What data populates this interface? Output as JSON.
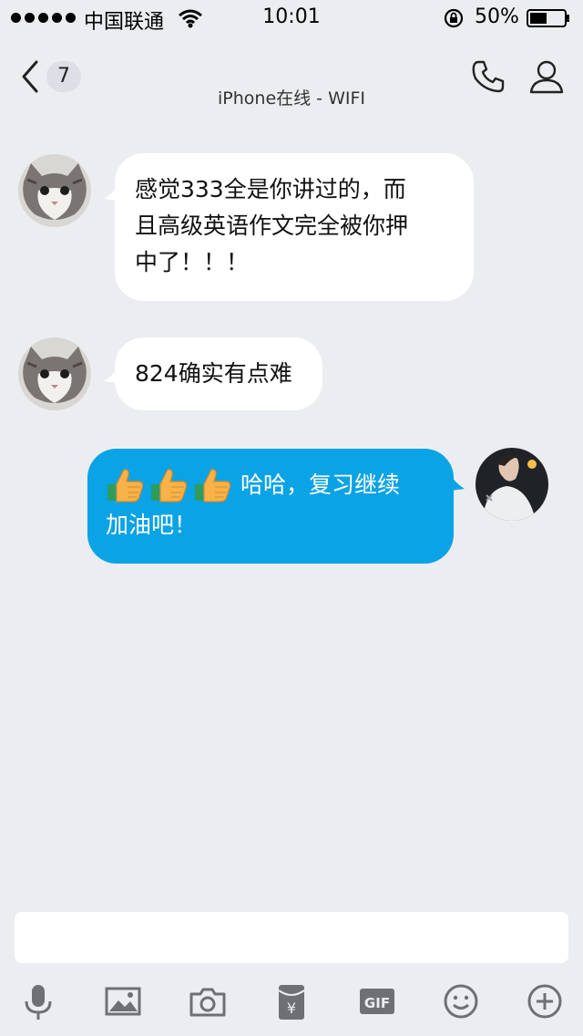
{
  "status_bar": {
    "carrier": "中国联通",
    "time": "10:01",
    "battery_percent": "50%",
    "battery_level": 0.5
  },
  "header": {
    "unread_count": "7",
    "subtitle": "iPhone在线 - WIFI"
  },
  "messages": [
    {
      "direction": "incoming",
      "line1": "感觉333全是你讲过的，而",
      "line2": "且高级英语作文完全被你押",
      "line3": "中了！！！"
    },
    {
      "direction": "incoming",
      "text": "824确实有点难"
    },
    {
      "direction": "outgoing",
      "emoji": "👍",
      "emoji_count": 3,
      "text_line1": "哈哈，复习继续",
      "text_line2": "加油吧！"
    }
  ],
  "input": {
    "placeholder": ""
  },
  "toolbar": {
    "items": [
      "microphone-icon",
      "image-icon",
      "camera-icon",
      "red-packet-icon",
      "gif-icon",
      "emoji-icon",
      "plus-icon"
    ],
    "gif_label": "GIF",
    "red_packet_label": "¥"
  },
  "colors": {
    "background": "#ebedf1",
    "outgoing_bubble": "#0aa3e5",
    "incoming_bubble": "#ffffff",
    "thumb": "#f7b248"
  }
}
